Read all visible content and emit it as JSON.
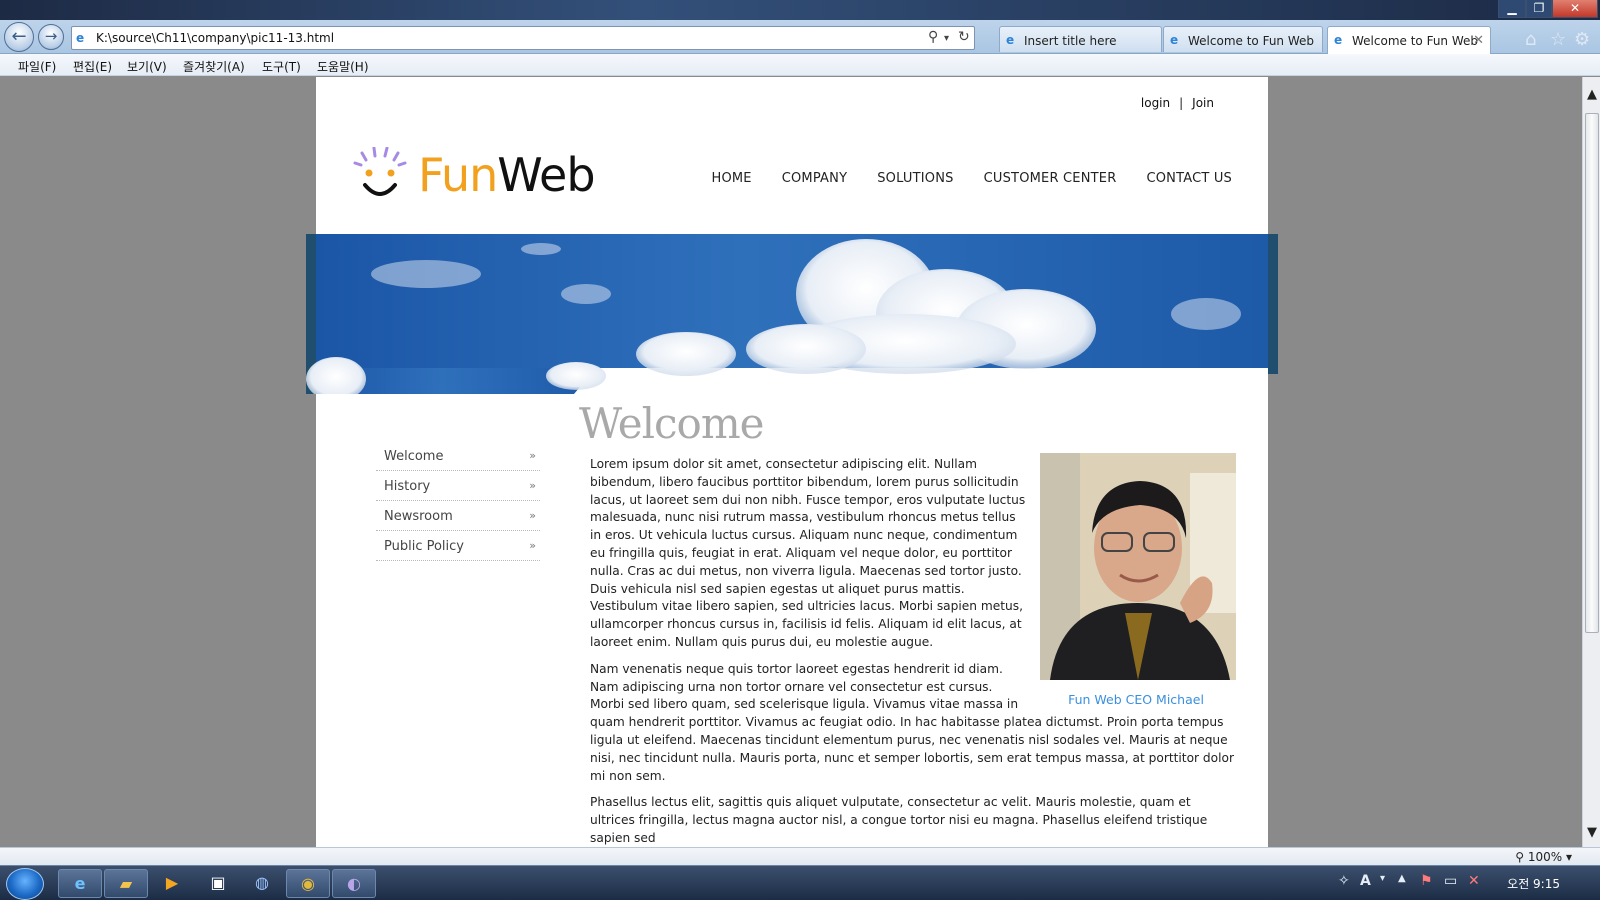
{
  "browser": {
    "address_url": "K:\\source\\Ch11\\company\\pic11-13.html",
    "tabs": [
      {
        "label": "Insert title here"
      },
      {
        "label": "Welcome to Fun Web"
      },
      {
        "label": "Welcome to Fun Web"
      }
    ],
    "menu": [
      "파일(F)",
      "편집(E)",
      "보기(V)",
      "즐겨찾기(A)",
      "도구(T)",
      "도움말(H)"
    ],
    "zoom": "100%"
  },
  "site": {
    "toplinks": {
      "login": "login",
      "separator": "|",
      "join": "Join"
    },
    "logo": {
      "fun": "Fun",
      "web": "Web"
    },
    "nav": [
      "HOME",
      "COMPANY",
      "SOLUTIONS",
      "CUSTOMER CENTER",
      "CONTACT US"
    ],
    "subnav": [
      "Welcome",
      "History",
      "Newsroom",
      "Public Policy"
    ],
    "subnav_chevron": "»",
    "heading": "Welcome",
    "photo_caption": "Fun Web CEO Michael",
    "paragraphs": [
      "Lorem ipsum dolor sit amet, consectetur adipiscing elit. Nullam bibendum, libero faucibus porttitor bibendum, lorem purus sollicitudin lacus, ut laoreet sem dui non nibh. Fusce tempor, eros vulputate luctus malesuada, nunc nisi rutrum massa, vestibulum rhoncus metus tellus in eros. Ut vehicula luctus cursus. Aliquam nunc neque, condimentum eu fringilla quis, feugiat in erat. Aliquam vel neque dolor, eu porttitor nulla. Cras ac dui metus, non viverra ligula. Maecenas sed tortor justo. Duis vehicula nisl sed sapien egestas ut aliquet purus mattis. Vestibulum vitae libero sapien, sed ultricies lacus. Morbi sapien metus, ullamcorper rhoncus cursus in, facilisis id felis. Aliquam id elit lacus, at laoreet enim. Nullam quis purus dui, eu molestie augue.",
      "Nam venenatis neque quis tortor laoreet egestas hendrerit id diam. Nam adipiscing urna non tortor ornare vel consectetur est cursus. Morbi sed libero quam, sed scelerisque ligula. Vivamus vitae massa in quam hendrerit porttitor. Vivamus ac feugiat odio. In hac habitasse platea dictumst. Proin porta tempus ligula ut eleifend. Maecenas tincidunt elementum purus, nec venenatis nisl sodales vel. Mauris at neque nisi, nec tincidunt nulla. Mauris porta, nunc et semper lobortis, sem erat tempus massa, at porttitor dolor mi non sem.",
      "Phasellus lectus elit, sagittis quis aliquet vulputate, consectetur ac velit. Mauris molestie, quam et ultrices fringilla, lectus magna auctor nisl, a congue tortor nisi eu magna. Phasellus eleifend tristique sapien sed"
    ]
  },
  "taskbar": {
    "clock": "오전 9:15"
  },
  "colors": {
    "accent_orange": "#f2a11f",
    "caption_blue": "#3a8fe0",
    "banner_blue": "#2c6cb6"
  },
  "icons": [
    "back-icon",
    "forward-icon",
    "search-icon",
    "refresh-icon",
    "ie-icon",
    "home-icon",
    "favorites-star-icon",
    "gear-icon",
    "windows-start-icon",
    "folder-icon",
    "media-player-icon",
    "chrome-icon"
  ]
}
